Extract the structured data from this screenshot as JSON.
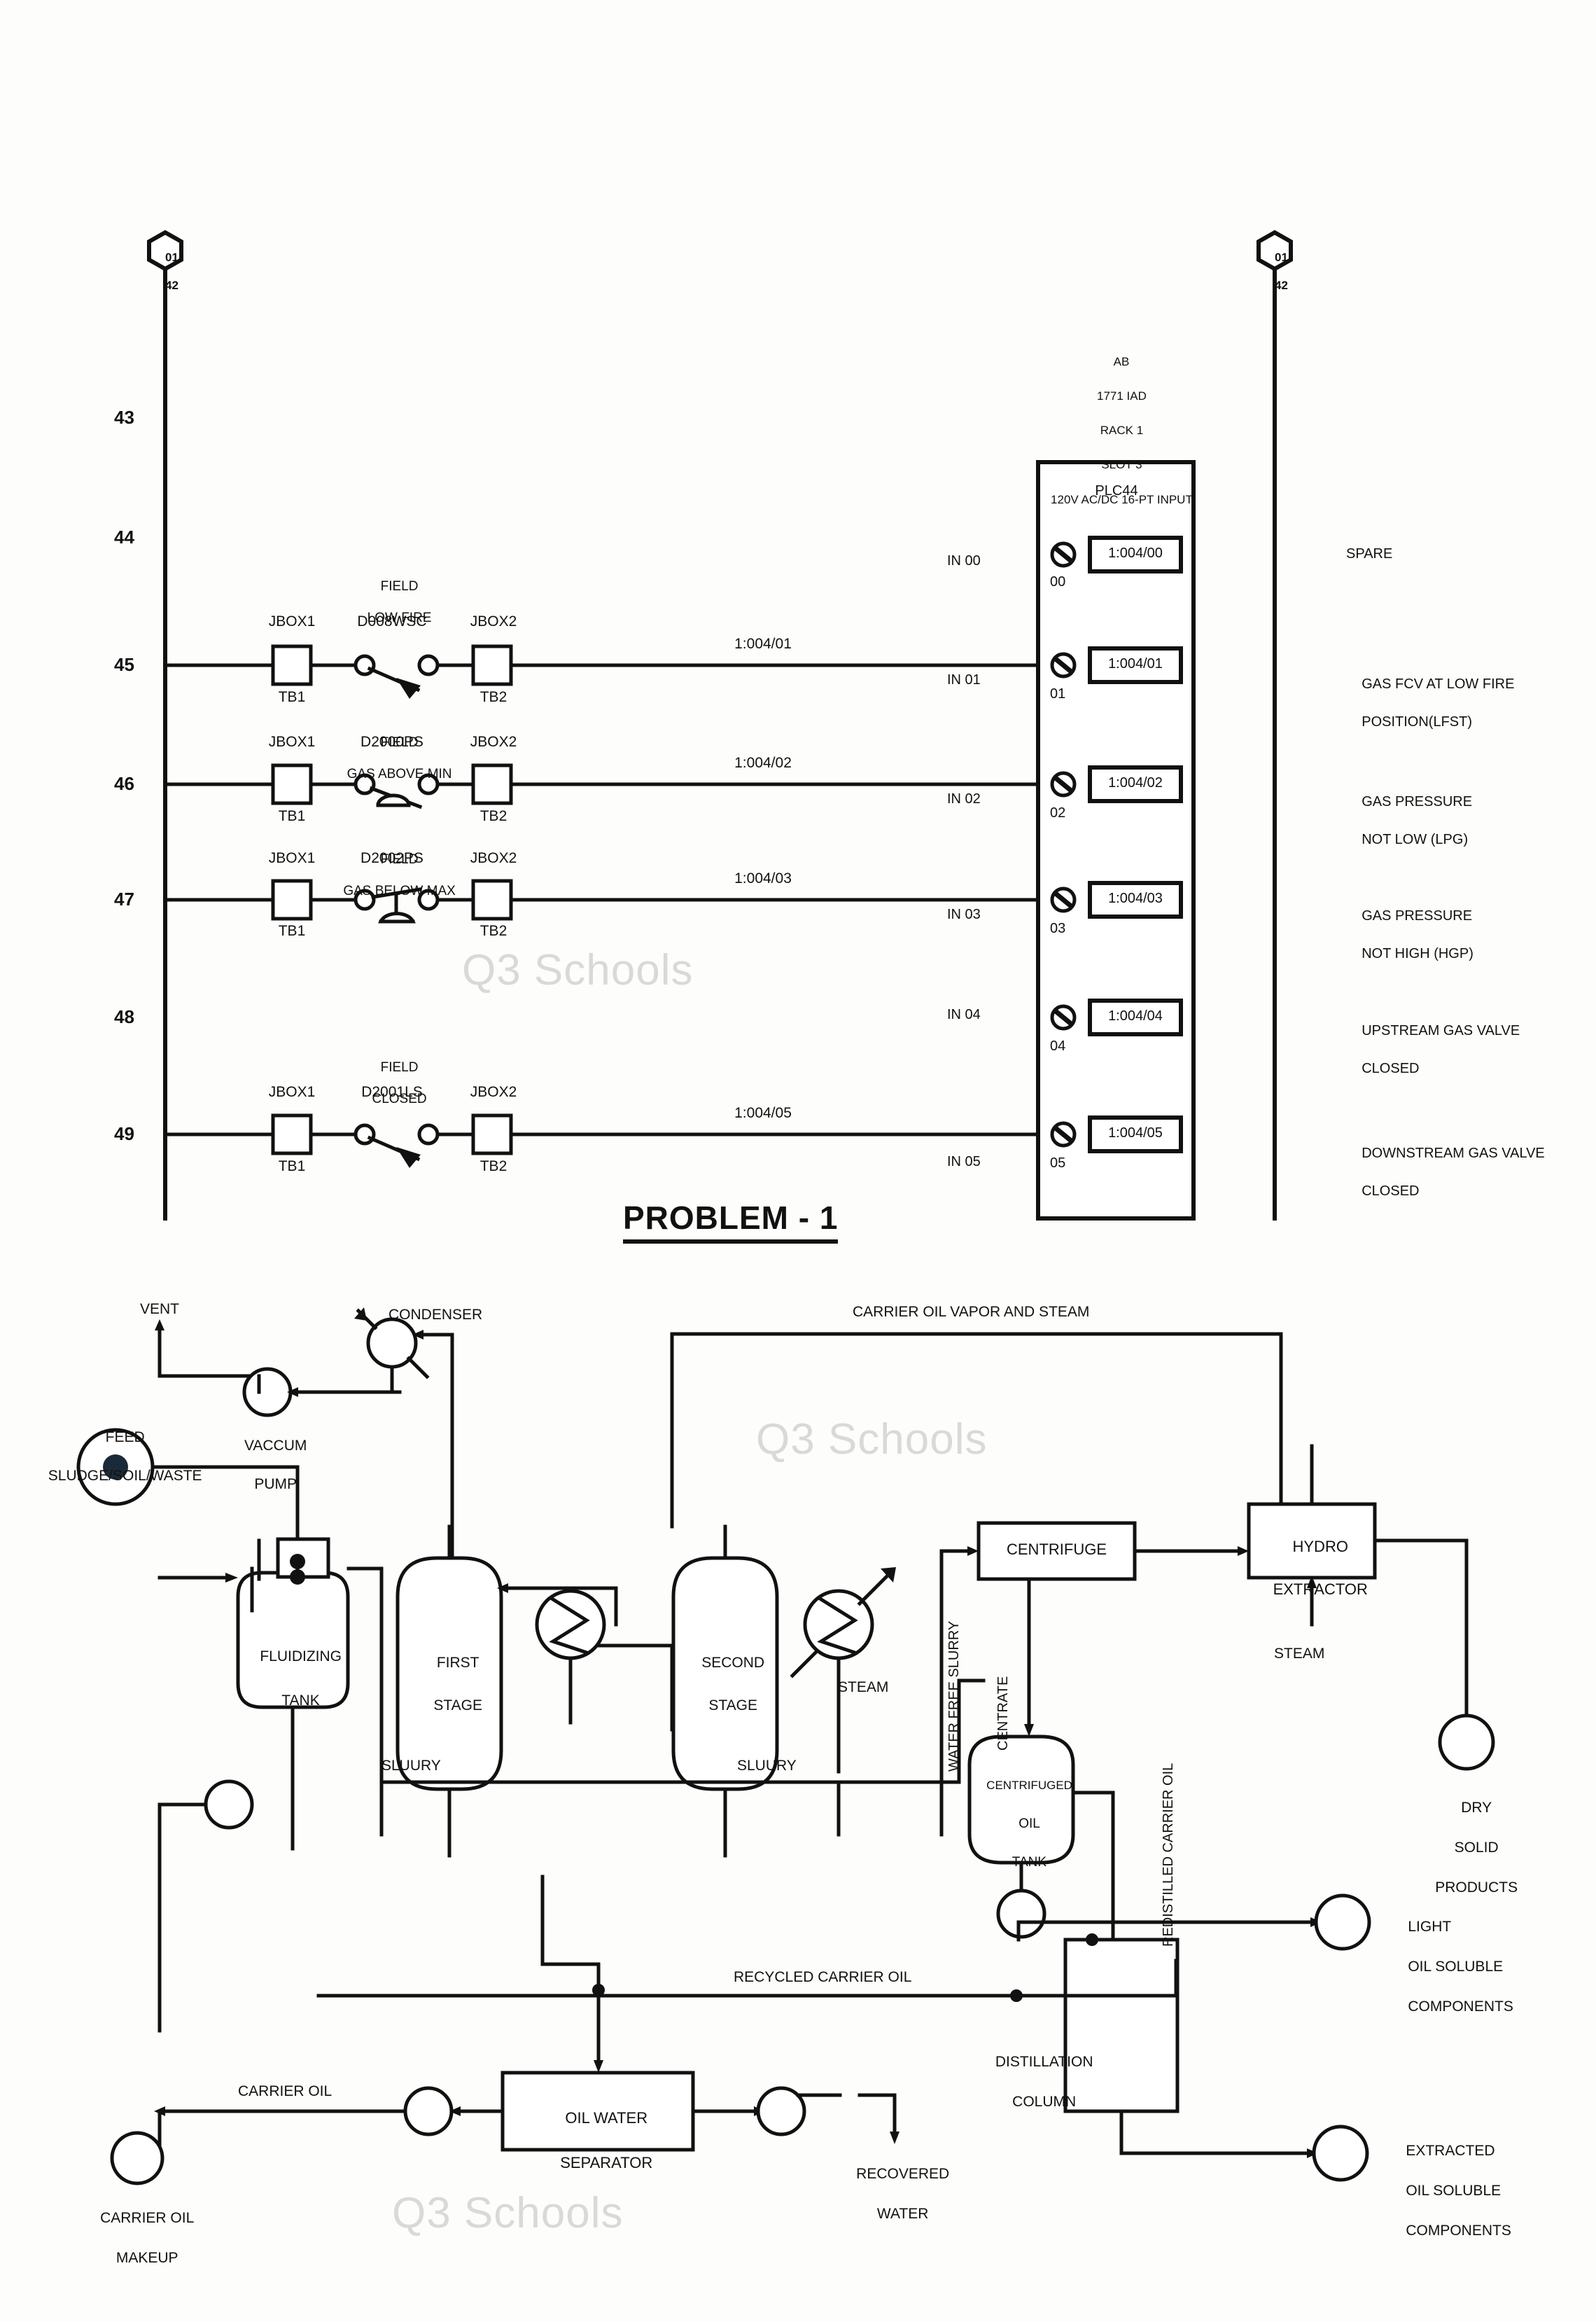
{
  "watermarks": [
    "Q3 Schools",
    "Q3 Schools",
    "Q3 Schools"
  ],
  "problem_title": "PROBLEM - 1",
  "ladder": {
    "left_hexagon": {
      "top": "01",
      "bottom": "42"
    },
    "right_hexagon": {
      "top": "01",
      "bottom": "42"
    },
    "module_header": [
      "AB",
      "1771 IAD",
      "RACK 1",
      "SLOT 3",
      "120V AC/DC 16-PT INPUT"
    ],
    "module_name": "PLC44",
    "rung_numbers": [
      "43",
      "44",
      "45",
      "46",
      "47",
      "48",
      "49"
    ],
    "rungs": [
      {
        "rung": "45",
        "field_label": [
          "FIELD",
          "LOW FIRE"
        ],
        "device_tag": "D008WSC",
        "jbox_left": "JBOX1",
        "tb_left": "TB1",
        "jbox_right": "JBOX2",
        "tb_right": "TB2",
        "wire_number": "1:004/01",
        "terminal_label": "IN 01",
        "terminal_number": "01",
        "plc_address": "1:004/01",
        "description": [
          "GAS FCV AT LOW FIRE",
          "POSITION(LFST)"
        ],
        "switch_type": "limit-switch-no"
      },
      {
        "rung": "46",
        "field_label": [
          "FIELD",
          "GAS ABOVE MIN"
        ],
        "device_tag": "D2000PS",
        "jbox_left": "JBOX1",
        "tb_left": "TB1",
        "jbox_right": "JBOX2",
        "tb_right": "TB2",
        "wire_number": "1:004/02",
        "terminal_label": "IN 02",
        "terminal_number": "02",
        "plc_address": "1:004/02",
        "description": [
          "GAS PRESSURE",
          "NOT LOW (LPG)"
        ],
        "switch_type": "pressure-switch-no"
      },
      {
        "rung": "47",
        "field_label": [
          "FIELD",
          "GAS BELOW MAX"
        ],
        "device_tag": "D2002PS",
        "jbox_left": "JBOX1",
        "tb_left": "TB1",
        "jbox_right": "JBOX2",
        "tb_right": "TB2",
        "wire_number": "1:004/03",
        "terminal_label": "IN 03",
        "terminal_number": "03",
        "plc_address": "1:004/03",
        "description": [
          "GAS PRESSURE",
          "NOT HIGH (HGP)"
        ],
        "switch_type": "pressure-switch-nc"
      },
      {
        "rung": "49",
        "field_label": [
          "FIELD",
          "CLOSED"
        ],
        "device_tag": "D2001LS",
        "jbox_left": "JBOX1",
        "tb_left": "TB1",
        "jbox_right": "JBOX2",
        "tb_right": "TB2",
        "wire_number": "1:004/05",
        "terminal_label": "IN 05",
        "terminal_number": "05",
        "plc_address": "1:004/05",
        "description": [
          "DOWNSTREAM GAS VALVE",
          "CLOSED"
        ],
        "switch_type": "limit-switch-no"
      }
    ],
    "unwired_points": [
      {
        "terminal_label": "IN 00",
        "terminal_number": "00",
        "plc_address": "1:004/00",
        "description": [
          "SPARE"
        ]
      },
      {
        "terminal_label": "IN 04",
        "terminal_number": "04",
        "plc_address": "1:004/04",
        "description": [
          "UPSTREAM GAS VALVE",
          "CLOSED"
        ]
      }
    ]
  },
  "process": {
    "labels": {
      "vent": "VENT",
      "condenser": "CONDENSER",
      "vacuum_pump": [
        "VACCUM",
        "PUMP"
      ],
      "feed": [
        "FEED",
        "SLUDGE/SOIL/WASTE"
      ],
      "carrier_oil_vapor_and_steam": "CARRIER OIL VAPOR AND STEAM",
      "fluidizing_tank": [
        "FLUIDIZING",
        "TANK"
      ],
      "first_stage": [
        "FIRST",
        "STAGE"
      ],
      "second_stage": [
        "SECOND",
        "STAGE"
      ],
      "steam_exchanger": "STEAM",
      "slurry_left": "SLUURY",
      "slurry_mid": "SLUURY",
      "centrifuge": "CENTRIFUGE",
      "hydro_extractor": [
        "HYDRO",
        "EXTRACTOR"
      ],
      "steam_hydro": "STEAM",
      "water_free_slurry": "WATER FREE SLURRY",
      "centrate": "CENTRATE",
      "centrifuged_oil_tank": [
        "CENTRIFUGED",
        "OIL",
        "TANK"
      ],
      "redistilled_carrier_oil": "REDISTILLED CARRIER OIL",
      "dry_solid_products": [
        "DRY",
        "SOLID",
        "PRODUCTS"
      ],
      "light_oil_soluble_components": [
        "LIGHT",
        "OIL SOLUBLE",
        "COMPONENTS"
      ],
      "recycled_carrier_oil": "RECYCLED CARRIER OIL",
      "distillation_column": [
        "DISTILLATION",
        "COLUMN"
      ],
      "oil_water_separator": [
        "OIL WATER",
        "SEPARATOR"
      ],
      "recovered_water": [
        "RECOVERED",
        "WATER"
      ],
      "carrier_oil": "CARRIER OIL",
      "carrier_oil_makeup": [
        "CARRIER OIL",
        "MAKEUP"
      ],
      "extracted_oil_soluble_components": [
        "EXTRACTED",
        "OIL SOLUBLE",
        "COMPONENTS"
      ]
    }
  },
  "colors": {
    "ink": "#111111",
    "paper": "#fdfdfb",
    "watermark": "#d9d9d9"
  }
}
